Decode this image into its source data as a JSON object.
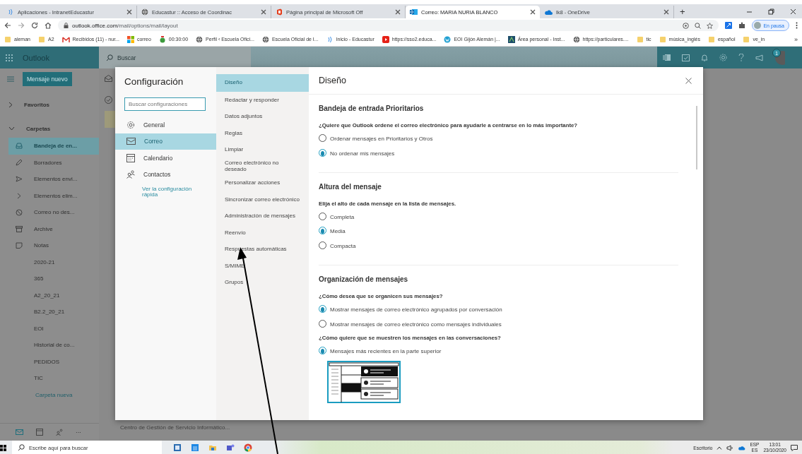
{
  "browser": {
    "tabs": [
      {
        "title": "Aplicaciones - IntranetEducastur",
        "selected": false,
        "kind": "educastur"
      },
      {
        "title": "Educastur :: Acceso de Coordinac",
        "selected": false,
        "kind": "globe"
      },
      {
        "title": "Página principal de Microsoft Off",
        "selected": false,
        "kind": "office"
      },
      {
        "title": "Correo: MARIA NURIA BLANCO",
        "selected": true,
        "kind": "outlook"
      },
      {
        "title": "lk8 - OneDrive",
        "selected": false,
        "kind": "cloud"
      }
    ],
    "new_tab": "+",
    "address_host": "outlook.office.com",
    "address_path": "/mail/options/mail/layout",
    "profile": "En pausa",
    "bookmarks": [
      {
        "label": "aleman",
        "kind": "folder"
      },
      {
        "label": "A2",
        "kind": "folder"
      },
      {
        "label": "Recibidos (11) - nur...",
        "kind": "gmail"
      },
      {
        "label": "correo",
        "kind": "windows"
      },
      {
        "label": "00:30:00",
        "kind": "timer"
      },
      {
        "label": "Perfil ‹ Escuela Ofici...",
        "kind": "globe"
      },
      {
        "label": "Escuela Oficial de I...",
        "kind": "globe"
      },
      {
        "label": "Inicio - Educastur",
        "kind": "educastur"
      },
      {
        "label": "https://sso2.educa...",
        "kind": "red"
      },
      {
        "label": "EOI Gijón Alemán |...",
        "kind": "wordpress"
      },
      {
        "label": "Área personal - Inst...",
        "kind": "moodle"
      },
      {
        "label": "https://particulares....",
        "kind": "globe"
      },
      {
        "label": "tic",
        "kind": "folder"
      },
      {
        "label": "música_inglés",
        "kind": "folder"
      },
      {
        "label": "español",
        "kind": "folder"
      },
      {
        "label": "ve_in",
        "kind": "folder"
      }
    ],
    "bookmarks_more": "»"
  },
  "outlook": {
    "app_name": "Outlook",
    "search_placeholder": "Buscar",
    "notification_count": "1",
    "new_message": "Mensaje nuevo",
    "favorites": {
      "label": "Favoritos",
      "expanded": false
    },
    "folders_group": {
      "label": "Carpetas",
      "expanded": true
    },
    "folders": [
      {
        "label": "Bandeja de en...",
        "kind": "inbox",
        "selected": true
      },
      {
        "label": "Borradores",
        "kind": "pencil",
        "selected": false
      },
      {
        "label": "Elementos envi...",
        "kind": "send",
        "selected": false
      },
      {
        "label": "Elementos elim...",
        "kind": "chevron",
        "selected": false
      },
      {
        "label": "Correo no des...",
        "kind": "block",
        "selected": false
      },
      {
        "label": "Archive",
        "kind": "archive",
        "selected": false
      },
      {
        "label": "Notas",
        "kind": "note",
        "selected": false
      },
      {
        "label": "2020-21",
        "kind": "plain",
        "selected": false
      },
      {
        "label": "365",
        "kind": "plain",
        "selected": false
      },
      {
        "label": "A2_20_21",
        "kind": "plain",
        "selected": false
      },
      {
        "label": "B2.2_20_21",
        "kind": "plain",
        "selected": false
      },
      {
        "label": "EOI",
        "kind": "plain",
        "selected": false
      },
      {
        "label": "Historial de co...",
        "kind": "plain",
        "selected": false
      },
      {
        "label": "PEDIDOS",
        "kind": "plain",
        "selected": false
      },
      {
        "label": "TIC",
        "kind": "plain",
        "selected": false
      }
    ],
    "new_folder": "Carpeta nueva",
    "more_apps": "···",
    "list_sender": "Centro de Gestión de Servicio Informático..."
  },
  "settings": {
    "title": "Configuración",
    "search_placeholder": "Buscar configuraciones",
    "categories": [
      {
        "label": "General",
        "kind": "gear",
        "selected": false
      },
      {
        "label": "Correo",
        "kind": "mail",
        "selected": true
      },
      {
        "label": "Calendario",
        "kind": "calendar",
        "selected": false
      },
      {
        "label": "Contactos",
        "kind": "people",
        "selected": false
      }
    ],
    "quick_link": "Ver la configuración rápida",
    "subcategories": [
      {
        "label": "Diseño",
        "selected": true
      },
      {
        "label": "Redactar y responder",
        "selected": false
      },
      {
        "label": "Datos adjuntos",
        "selected": false
      },
      {
        "label": "Reglas",
        "selected": false
      },
      {
        "label": "Limpiar",
        "selected": false
      },
      {
        "label": "Correo electrónico no deseado",
        "selected": false
      },
      {
        "label": "Personalizar acciones",
        "selected": false
      },
      {
        "label": "Sincronizar correo electrónico",
        "selected": false
      },
      {
        "label": "Administración de mensajes",
        "selected": false
      },
      {
        "label": "Reenvío",
        "selected": false
      },
      {
        "label": "Respuestas automáticas",
        "selected": false
      },
      {
        "label": "S/MIME",
        "selected": false
      },
      {
        "label": "Grupos",
        "selected": false
      }
    ],
    "panel_title": "Diseño",
    "sections": [
      {
        "heading": "Bandeja de entrada Prioritarios",
        "questions": [
          {
            "text": "¿Quiere que Outlook ordene el correo electrónico para ayudarle a centrarse en lo más importante?",
            "options": [
              {
                "label": "Ordenar mensajes en Prioritarios y Otros",
                "selected": false
              },
              {
                "label": "No ordenar mis mensajes",
                "selected": true
              }
            ]
          }
        ]
      },
      {
        "heading": "Altura del mensaje",
        "questions": [
          {
            "text": "Elija el alto de cada mensaje en la lista de mensajes.",
            "options": [
              {
                "label": "Completa",
                "selected": false
              },
              {
                "label": "Media",
                "selected": true
              },
              {
                "label": "Compacta",
                "selected": false
              }
            ]
          }
        ]
      },
      {
        "heading": "Organización de mensajes",
        "questions": [
          {
            "text": "¿Cómo desea que se organicen sus mensajes?",
            "options": [
              {
                "label": "Mostrar mensajes de correo electrónico agrupados por conversación",
                "selected": true
              },
              {
                "label": "Mostrar mensajes de correo electrónico como mensajes individuales",
                "selected": false
              }
            ]
          },
          {
            "text": "¿Cómo quiere que se muestren los mensajes en las conversaciones?",
            "options": [
              {
                "label": "Mensajes más recientes en la parte superior",
                "selected": true
              }
            ]
          }
        ]
      }
    ]
  },
  "taskbar": {
    "search_placeholder": "Escribe aquí para buscar",
    "desktop": "Escritorio",
    "lang_top": "ESP",
    "lang_bottom": "ES",
    "time": "13:01",
    "date": "23/10/2020"
  }
}
